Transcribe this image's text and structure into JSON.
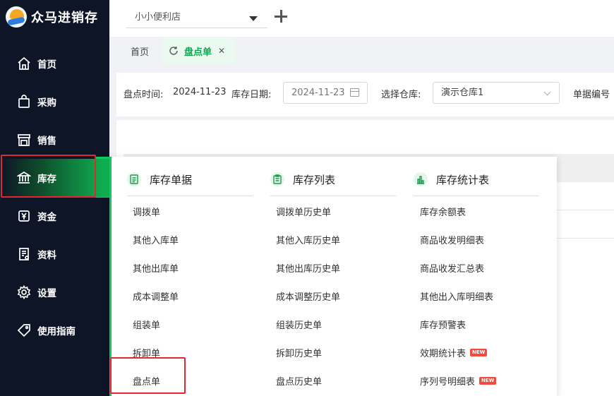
{
  "app": {
    "name": "众马进销存"
  },
  "sidebar": {
    "items": [
      {
        "label": "首页",
        "icon": "home-icon"
      },
      {
        "label": "采购",
        "icon": "bag-icon"
      },
      {
        "label": "销售",
        "icon": "store-icon"
      },
      {
        "label": "库存",
        "icon": "bank-icon",
        "active": true
      },
      {
        "label": "资金",
        "icon": "yen-icon"
      },
      {
        "label": "资料",
        "icon": "document-icon"
      },
      {
        "label": "设置",
        "icon": "gear-icon"
      },
      {
        "label": "使用指南",
        "icon": "tag-icon"
      }
    ]
  },
  "header": {
    "store": "小小便利店"
  },
  "tabs": [
    {
      "label": "首页"
    },
    {
      "label": "盘点单",
      "active": true
    }
  ],
  "filters": {
    "count_time_label": "盘点时间:",
    "count_time_value": "2024-11-23",
    "stock_date_label": "库存日期:",
    "stock_date_value": "2024-11-23",
    "warehouse_label": "选择仓库:",
    "warehouse_value": "演示仓库1",
    "doc_no_label": "单据编号"
  },
  "menu": {
    "columns": [
      {
        "title": "库存单据",
        "items": [
          "调拨单",
          "其他入库单",
          "其他出库单",
          "成本调整单",
          "组装单",
          "拆卸单",
          "盘点单"
        ]
      },
      {
        "title": "库存列表",
        "items": [
          "调拨单历史单",
          "其他入库历史单",
          "其他出库历史单",
          "成本调整历史单",
          "组装历史单",
          "拆卸历史单",
          "盘点历史单"
        ]
      },
      {
        "title": "库存统计表",
        "items": [
          "库存余额表",
          "商品收发明细表",
          "商品收发汇总表",
          "其他出入库明细表",
          "库存预警表",
          "效期统计表",
          "序列号明细表"
        ]
      }
    ],
    "new_badge": "NEW"
  },
  "colors": {
    "accent": "#12c95a",
    "sidebar_bg": "#0d1526",
    "highlight_border": "#e0282e"
  }
}
